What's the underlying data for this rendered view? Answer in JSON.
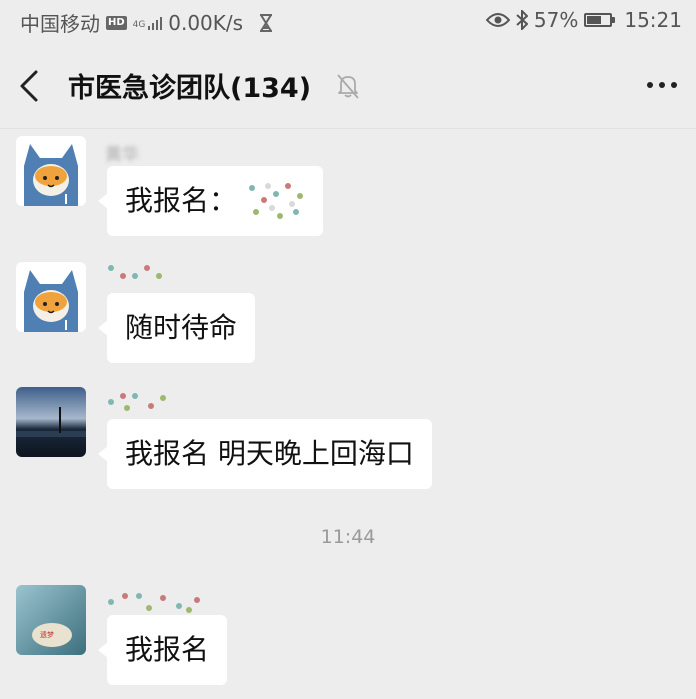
{
  "status_bar": {
    "carrier": "中国移动",
    "hd": "HD",
    "network": "4G",
    "speed": "0.00K/s",
    "battery_text": "57%",
    "battery_level": 0.57,
    "time": "15:21",
    "icons": [
      "hourglass-icon",
      "eye-icon",
      "bluetooth-icon",
      "battery-icon",
      "signal-icon"
    ]
  },
  "header": {
    "title": "市医急诊团队(134)",
    "icons": [
      "back-arrow-icon",
      "mute-bell-icon",
      "more-icon"
    ]
  },
  "messages": [
    {
      "sender": "黄华",
      "text": "我报名：",
      "avatar": "cat-hoodie-avatar"
    },
    {
      "sender": "",
      "text": "随时待命",
      "avatar": "cat-hoodie-avatar"
    },
    {
      "sender": "",
      "text": "我报名  明天晚上回海口",
      "avatar": "night-scenery-avatar"
    },
    {
      "sender": "",
      "text": "我报名",
      "avatar": "stone-scenery-avatar"
    }
  ],
  "timestamp": "11:44",
  "colors": {
    "background": "#ededed",
    "bubble": "#ffffff",
    "text": "#111111",
    "muted": "#9a9a9a"
  }
}
